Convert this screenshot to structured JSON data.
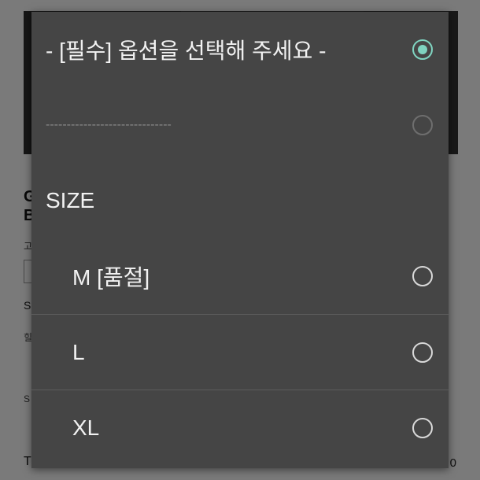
{
  "background_page": {
    "product_title_line1": "G",
    "product_title_line2": "B",
    "small_label": "고",
    "s_label": "S",
    "s_label2": "힐",
    "s_label3": "S",
    "total_label": "T",
    "total_value": "0"
  },
  "dropdown": {
    "accent_color": "#7fd3c0",
    "options": [
      {
        "label": "- [필수] 옵션을 선택해 주세요 -",
        "selected": true,
        "disabled": false
      },
      {
        "label": "------------------------------",
        "selected": false,
        "disabled": true
      },
      {
        "label": "SIZE",
        "is_group_header": true
      },
      {
        "label": "M [품절]",
        "selected": false,
        "disabled": false
      },
      {
        "label": "L",
        "selected": false,
        "disabled": false
      },
      {
        "label": "XL",
        "selected": false,
        "disabled": false
      }
    ]
  }
}
